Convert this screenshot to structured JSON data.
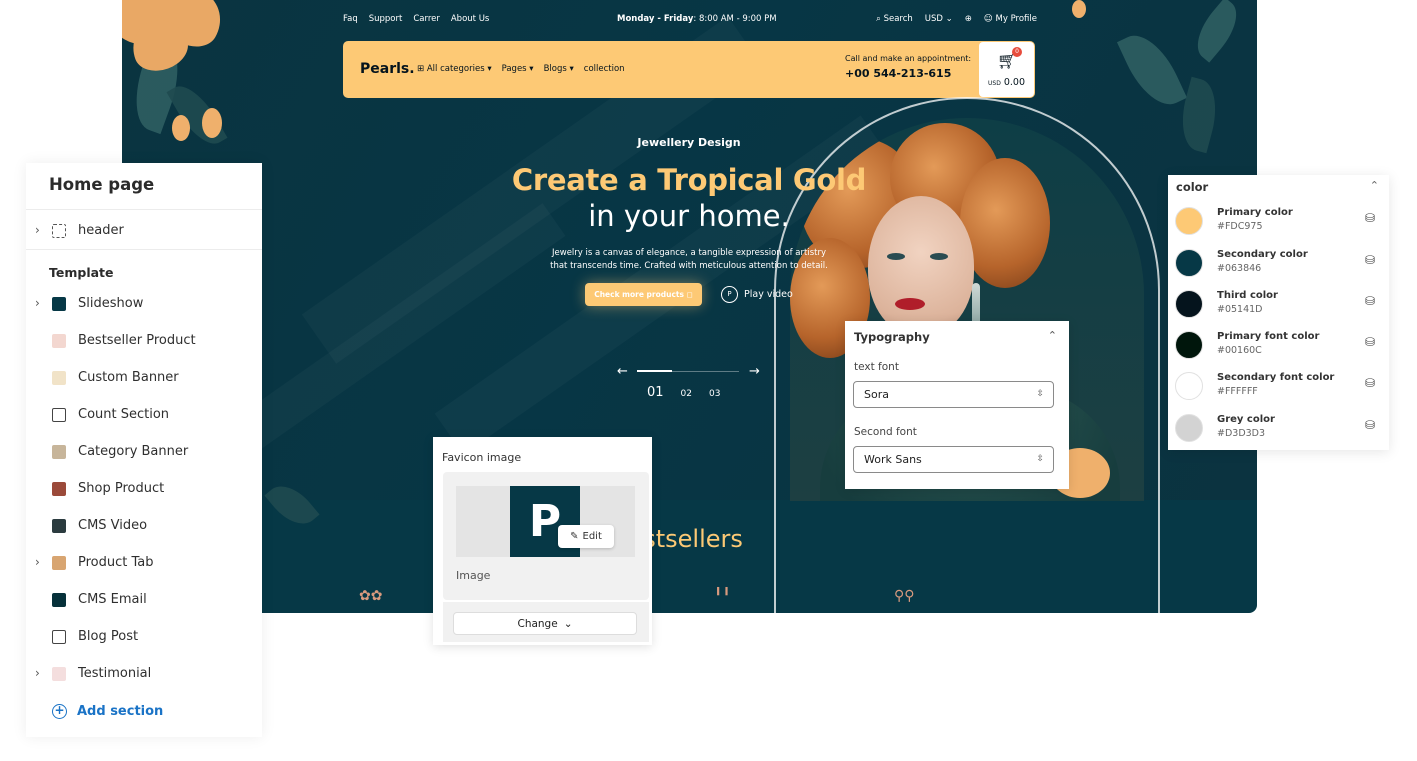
{
  "preview": {
    "topnav": {
      "links": [
        "Faq",
        "Support",
        "Carrer",
        "About Us"
      ],
      "hours_label": "Monday - Friday",
      "hours_value": ": 8:00 AM - 9:00 PM",
      "search": "Search",
      "currency": "USD",
      "profile": "My Profile"
    },
    "header": {
      "brand": "Pearls.",
      "menu": [
        "All categories",
        "Pages",
        "Blogs",
        "collection"
      ],
      "call_label": "Call and make an appointment:",
      "call_phone": "+00 544-213-615",
      "cart_badge": "0",
      "cart_currency": "USD",
      "cart_amount": "0.00"
    },
    "hero": {
      "eyebrow": "Jewellery Design",
      "title_line1": "Create a Tropical Gold",
      "title_line2": "in your home.",
      "description": "Jewelry is a canvas of elegance, a tangible expression of artistry\nthat transcends time. Crafted with meticulous attention to detail.",
      "cta": "Check more products",
      "play": "Play video",
      "play_icon": "P",
      "slides": [
        "01",
        "02",
        "03"
      ]
    },
    "bestsellers_title": "Bestsellers"
  },
  "left_panel": {
    "title": "Home page",
    "header_item": "header",
    "section_title": "Template",
    "items": [
      {
        "label": "Slideshow",
        "chevron": true
      },
      {
        "label": "Bestseller Product",
        "chevron": false
      },
      {
        "label": "Custom Banner",
        "chevron": false
      },
      {
        "label": "Count Section",
        "chevron": false
      },
      {
        "label": "Category Banner",
        "chevron": false
      },
      {
        "label": "Shop Product",
        "chevron": false
      },
      {
        "label": "CMS Video",
        "chevron": false
      },
      {
        "label": "Product Tab",
        "chevron": true
      },
      {
        "label": "CMS Email",
        "chevron": false
      },
      {
        "label": "Blog Post",
        "chevron": false
      },
      {
        "label": "Testimonial",
        "chevron": true
      }
    ],
    "add_section": "Add section"
  },
  "favicon": {
    "title": "Favicon image",
    "logo_letter": "P",
    "edit": "Edit",
    "caption": "Image",
    "change": "Change"
  },
  "typography": {
    "title": "Typography",
    "text_font_label": "text font",
    "text_font_value": "Sora",
    "second_font_label": "Second font",
    "second_font_value": "Work Sans"
  },
  "color_panel": {
    "title": "color",
    "colors": [
      {
        "name": "Primary color",
        "hex": "#FDC975"
      },
      {
        "name": "Secondary color",
        "hex": "#063846"
      },
      {
        "name": "Third color",
        "hex": "#05141D"
      },
      {
        "name": "Primary font color",
        "hex": "#00160C"
      },
      {
        "name": "Secondary font color",
        "hex": "#FFFFFF"
      },
      {
        "name": "Grey color",
        "hex": "#D3D3D3"
      }
    ]
  }
}
